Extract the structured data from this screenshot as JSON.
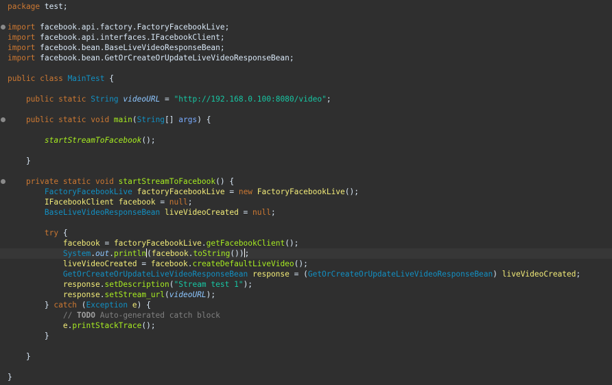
{
  "editor": {
    "lines": [
      [
        {
          "t": "package",
          "c": "kw"
        },
        {
          "t": " test;",
          "c": ""
        }
      ],
      [],
      [
        {
          "t": "import",
          "c": "kw"
        },
        {
          "t": " facebook.api.factory.FactoryFacebookLive;",
          "c": ""
        }
      ],
      [
        {
          "t": "import",
          "c": "kw"
        },
        {
          "t": " facebook.api.interfaces.IFacebookClient;",
          "c": ""
        }
      ],
      [
        {
          "t": "import",
          "c": "kw"
        },
        {
          "t": " facebook.bean.BaseLiveVideoResponseBean;",
          "c": ""
        }
      ],
      [
        {
          "t": "import",
          "c": "kw"
        },
        {
          "t": " facebook.bean.GetOrCreateOrUpdateLiveVideoResponseBean;",
          "c": ""
        }
      ],
      [],
      [
        {
          "t": "public class ",
          "c": "kw"
        },
        {
          "t": "MainTest",
          "c": "cls"
        },
        {
          "t": " {",
          "c": ""
        }
      ],
      [],
      [
        {
          "t": "    public static ",
          "c": "kw"
        },
        {
          "t": "String",
          "c": "cls"
        },
        {
          "t": " ",
          "c": ""
        },
        {
          "t": "videoURL",
          "c": "sfld"
        },
        {
          "t": " = ",
          "c": ""
        },
        {
          "t": "\"http://192.168.0.100:8080/video\"",
          "c": "str"
        },
        {
          "t": ";",
          "c": ""
        }
      ],
      [],
      [
        {
          "t": "    public static void ",
          "c": "kw"
        },
        {
          "t": "main",
          "c": "mth"
        },
        {
          "t": "(",
          "c": ""
        },
        {
          "t": "String",
          "c": "cls"
        },
        {
          "t": "[] ",
          "c": ""
        },
        {
          "t": "args",
          "c": "param"
        },
        {
          "t": ") {",
          "c": ""
        }
      ],
      [],
      [
        {
          "t": "        ",
          "c": ""
        },
        {
          "t": "startStreamToFacebook",
          "c": "smth"
        },
        {
          "t": "();",
          "c": ""
        }
      ],
      [],
      [
        {
          "t": "    }",
          "c": ""
        }
      ],
      [],
      [
        {
          "t": "    private static void ",
          "c": "kw"
        },
        {
          "t": "startStreamToFacebook",
          "c": "mth"
        },
        {
          "t": "() {",
          "c": ""
        }
      ],
      [
        {
          "t": "        ",
          "c": ""
        },
        {
          "t": "FactoryFacebookLive",
          "c": "cls"
        },
        {
          "t": " ",
          "c": ""
        },
        {
          "t": "factoryFacebookLive",
          "c": "loc"
        },
        {
          "t": " = ",
          "c": ""
        },
        {
          "t": "new",
          "c": "kw"
        },
        {
          "t": " ",
          "c": ""
        },
        {
          "t": "FactoryFacebookLive",
          "c": "loc"
        },
        {
          "t": "();",
          "c": ""
        }
      ],
      [
        {
          "t": "        ",
          "c": ""
        },
        {
          "t": "IFacebookClient",
          "c": "loc"
        },
        {
          "t": " ",
          "c": ""
        },
        {
          "t": "facebook",
          "c": "loc"
        },
        {
          "t": " = ",
          "c": ""
        },
        {
          "t": "null",
          "c": "kw"
        },
        {
          "t": ";",
          "c": ""
        }
      ],
      [
        {
          "t": "        ",
          "c": ""
        },
        {
          "t": "BaseLiveVideoResponseBean",
          "c": "cls"
        },
        {
          "t": " ",
          "c": ""
        },
        {
          "t": "liveVideoCreated",
          "c": "loc"
        },
        {
          "t": " = ",
          "c": ""
        },
        {
          "t": "null",
          "c": "kw"
        },
        {
          "t": ";",
          "c": ""
        }
      ],
      [],
      [
        {
          "t": "        ",
          "c": ""
        },
        {
          "t": "try",
          "c": "kw"
        },
        {
          "t": " {",
          "c": ""
        }
      ],
      [
        {
          "t": "            ",
          "c": ""
        },
        {
          "t": "facebook",
          "c": "loc"
        },
        {
          "t": " = ",
          "c": ""
        },
        {
          "t": "factoryFacebookLive",
          "c": "loc"
        },
        {
          "t": ".",
          "c": ""
        },
        {
          "t": "getFacebookClient",
          "c": "mth"
        },
        {
          "t": "();",
          "c": ""
        }
      ],
      [
        {
          "t": "            ",
          "c": ""
        },
        {
          "t": "System",
          "c": "cls"
        },
        {
          "t": ".",
          "c": ""
        },
        {
          "t": "out",
          "c": "sfld"
        },
        {
          "t": ".",
          "c": ""
        },
        {
          "t": "println",
          "c": "mth"
        },
        {
          "t": "CARET",
          "c": "caret"
        },
        {
          "t": "(",
          "c": ""
        },
        {
          "t": "facebook",
          "c": "loc"
        },
        {
          "t": ".",
          "c": ""
        },
        {
          "t": "toString",
          "c": "mth"
        },
        {
          "t": "())",
          "c": ""
        },
        {
          "t": "CARET",
          "c": "caret"
        },
        {
          "t": ";",
          "c": ""
        }
      ],
      [
        {
          "t": "            ",
          "c": ""
        },
        {
          "t": "liveVideoCreated",
          "c": "loc"
        },
        {
          "t": " = ",
          "c": ""
        },
        {
          "t": "facebook",
          "c": "loc"
        },
        {
          "t": ".",
          "c": ""
        },
        {
          "t": "createDefaultLiveVideo",
          "c": "mth"
        },
        {
          "t": "();",
          "c": ""
        }
      ],
      [
        {
          "t": "            ",
          "c": ""
        },
        {
          "t": "GetOrCreateOrUpdateLiveVideoResponseBean",
          "c": "cls"
        },
        {
          "t": " ",
          "c": ""
        },
        {
          "t": "response",
          "c": "loc"
        },
        {
          "t": " = (",
          "c": ""
        },
        {
          "t": "GetOrCreateOrUpdateLiveVideoResponseBean",
          "c": "cls"
        },
        {
          "t": ") ",
          "c": ""
        },
        {
          "t": "liveVideoCreated",
          "c": "loc"
        },
        {
          "t": ";",
          "c": ""
        }
      ],
      [
        {
          "t": "            ",
          "c": ""
        },
        {
          "t": "response",
          "c": "loc"
        },
        {
          "t": ".",
          "c": ""
        },
        {
          "t": "setDescription",
          "c": "mth"
        },
        {
          "t": "(",
          "c": ""
        },
        {
          "t": "\"Stream test 1\"",
          "c": "str"
        },
        {
          "t": ");",
          "c": ""
        }
      ],
      [
        {
          "t": "            ",
          "c": ""
        },
        {
          "t": "response",
          "c": "loc"
        },
        {
          "t": ".",
          "c": ""
        },
        {
          "t": "setStream_url",
          "c": "mth"
        },
        {
          "t": "(",
          "c": ""
        },
        {
          "t": "videoURL",
          "c": "sfld"
        },
        {
          "t": ");",
          "c": ""
        }
      ],
      [
        {
          "t": "        } ",
          "c": ""
        },
        {
          "t": "catch",
          "c": "kw"
        },
        {
          "t": " (",
          "c": ""
        },
        {
          "t": "Exception",
          "c": "cls"
        },
        {
          "t": " ",
          "c": ""
        },
        {
          "t": "e",
          "c": "loc"
        },
        {
          "t": ") {",
          "c": ""
        }
      ],
      [
        {
          "t": "            ",
          "c": ""
        },
        {
          "t": "// ",
          "c": "cmt"
        },
        {
          "t": "TODO",
          "c": "todo"
        },
        {
          "t": " Auto-generated catch block",
          "c": "cmt"
        }
      ],
      [
        {
          "t": "            ",
          "c": ""
        },
        {
          "t": "e",
          "c": "loc"
        },
        {
          "t": ".",
          "c": ""
        },
        {
          "t": "printStackTrace",
          "c": "mth"
        },
        {
          "t": "();",
          "c": ""
        }
      ],
      [
        {
          "t": "        }",
          "c": ""
        }
      ],
      [],
      [
        {
          "t": "    }",
          "c": ""
        }
      ],
      [],
      [
        {
          "t": "}",
          "c": ""
        }
      ]
    ],
    "current_line": 24,
    "fold_lines": [
      2,
      11,
      17
    ]
  }
}
